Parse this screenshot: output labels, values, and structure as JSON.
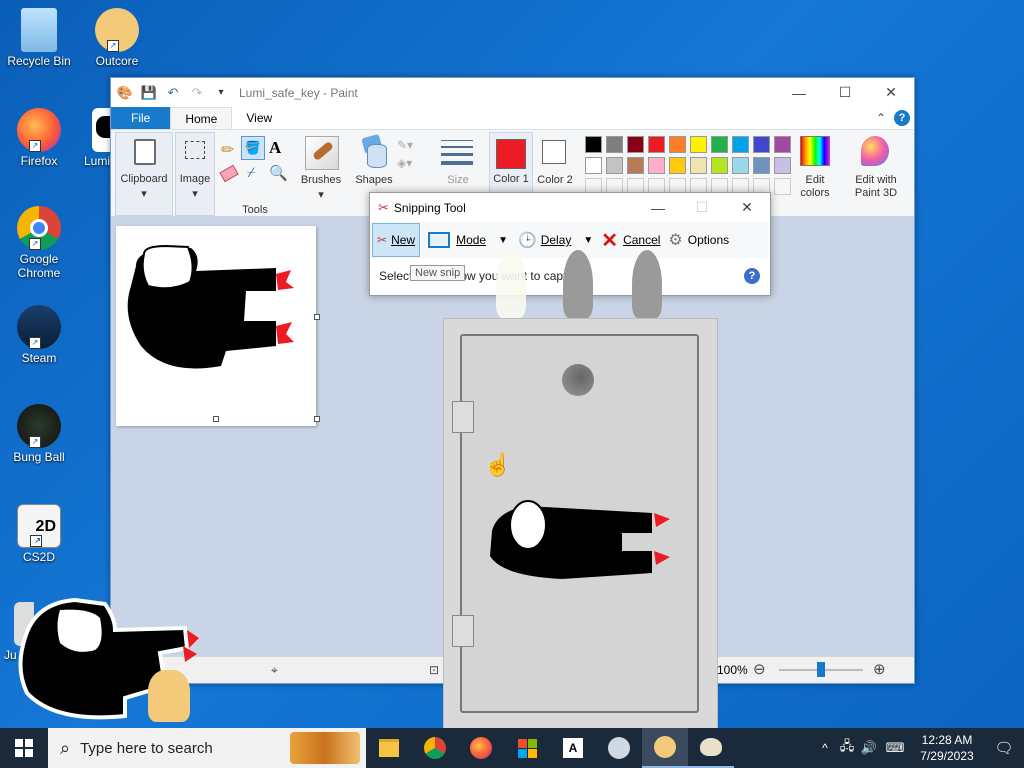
{
  "desktop": {
    "icons": [
      {
        "label": "Recycle Bin"
      },
      {
        "label": "Outcore"
      },
      {
        "label": "Firefox"
      },
      {
        "label": "Lumi"
      },
      {
        "label": "Google Chrome"
      },
      {
        "label": "Steam"
      },
      {
        "label": "Bung Ball"
      },
      {
        "label": "CS2D"
      },
      {
        "label": "Ju"
      }
    ]
  },
  "paint": {
    "title": "Lumi_safe_key - Paint",
    "tabs": {
      "file": "File",
      "home": "Home",
      "view": "View"
    },
    "ribbon": {
      "clipboard": "Clipboard",
      "image": "Image",
      "tools": "Tools",
      "brushes": "Brushes",
      "shapes": "Shapes",
      "size": "Size",
      "color1": "Color 1",
      "color2": "Color 2",
      "edit_colors": "Edit colors",
      "edit_paint3d": "Edit with Paint 3D"
    },
    "palette": [
      "#000000",
      "#7f7f7f",
      "#880015",
      "#ed1c24",
      "#ff7f27",
      "#fff200",
      "#22b14c",
      "#00a2e8",
      "#3f48cc",
      "#a349a4",
      "#ffffff",
      "#c3c3c3",
      "#b97a57",
      "#ffaec9",
      "#ffc90e",
      "#efe4b0",
      "#b5e61d",
      "#99d9ea",
      "#7092be",
      "#c8bfe7"
    ],
    "color1_value": "#ed1c24",
    "status": {
      "zoom": "100%",
      "zoom_level": 0.5
    }
  },
  "snipping": {
    "title": "Snipping Tool",
    "new": "New",
    "mode": "Mode",
    "delay": "Delay",
    "cancel": "Cancel",
    "options": "Options",
    "hint": "Select the window you want to capture.",
    "tooltip": "New snip"
  },
  "taskbar": {
    "search_placeholder": "Type here to search",
    "time": "12:28 AM",
    "date": "7/29/2023"
  }
}
